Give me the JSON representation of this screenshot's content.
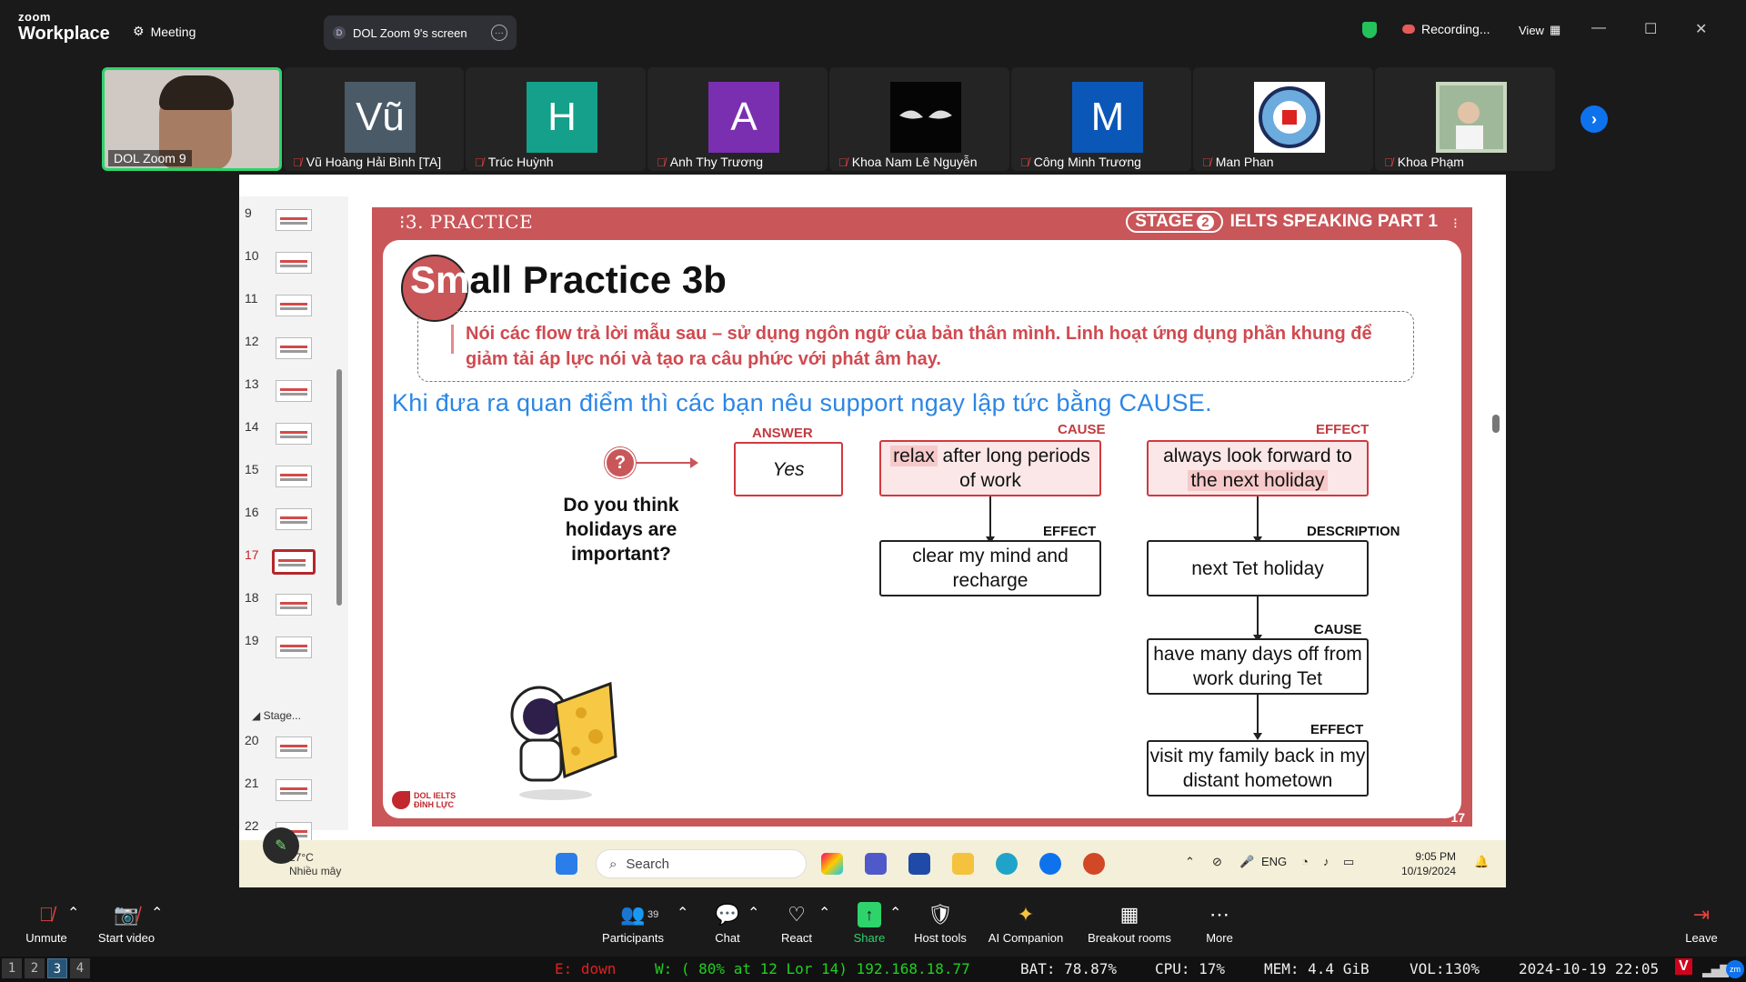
{
  "app": {
    "logo_line1": "zoom",
    "logo_line2": "Workplace",
    "meeting_label": "Meeting",
    "share_name": "DOL Zoom 9's screen",
    "share_badge": "D",
    "recording": "Recording...",
    "view": "View"
  },
  "participants": [
    {
      "name": "DOL Zoom 9",
      "initial": "",
      "color": ""
    },
    {
      "name": "Vũ Hoàng Hải Bình [TA]",
      "initial": "Vũ",
      "color": "#4a5a66"
    },
    {
      "name": "Trúc Huỳnh",
      "initial": "H",
      "color": "#14a08a"
    },
    {
      "name": "Anh Thy Trương",
      "initial": "A",
      "color": "#7a2fb0"
    },
    {
      "name": "Khoa Nam Lê Nguyễn",
      "initial": "",
      "color": "#050505"
    },
    {
      "name": "Công Minh Trương",
      "initial": "M",
      "color": "#0a57b8"
    },
    {
      "name": "Man Phan",
      "initial": "",
      "color": "#ffffff"
    },
    {
      "name": "Khoa Phạm",
      "initial": "",
      "color": "#c8d8c0"
    }
  ],
  "slides_panel": {
    "numbers": [
      "9",
      "10",
      "11",
      "12",
      "13",
      "14",
      "15",
      "16",
      "17",
      "18",
      "19",
      "20",
      "21",
      "22"
    ],
    "active": "17",
    "section": "Stage..."
  },
  "slide": {
    "section_header": "3. PRACTICE",
    "stage_label": "STAGE",
    "stage_num": "2",
    "part_label": "IELTS SPEAKING PART 1",
    "title_sm": "Sm",
    "title_rest": "all Practice 3b",
    "instruction": "Nói các flow trả lời mẫu sau – sử dụng ngôn ngữ của bản thân mình. Linh hoạt ứng dụng phần khung để giảm tải áp lực nói và tạo ra câu phức với phát âm hay.",
    "subline": "Khi đưa ra quan điểm thì các bạn nêu support ngay lập tức bằng CAUSE.",
    "question_mark": "?",
    "question": "Do you think holidays are important?",
    "answer_label": "ANSWER",
    "answer": "Yes",
    "cause_label": "CAUSE",
    "cause_hl": "relax",
    "cause_rest": " after long periods of work",
    "effect_label_1": "EFFECT",
    "effect_1": "clear my mind and recharge",
    "effect_label_2": "EFFECT",
    "effect_2_a": "always look forward to ",
    "effect_2_hl": "the next holiday",
    "desc_label": "DESCRIPTION",
    "desc": "next Tet holiday",
    "cause_label_2": "CAUSE",
    "cause_2": "have many days off from work during Tet",
    "effect_label_3": "EFFECT",
    "effect_3": "visit my family back in my distant hometown",
    "brand_1": "DOL IELTS",
    "brand_2": "ĐÌNH LỰC",
    "page": "17"
  },
  "win_taskbar": {
    "temp": "27°C",
    "weather": "Nhiều mây",
    "search": "Search",
    "lang": "ENG",
    "time": "9:05 PM",
    "date": "10/19/2024"
  },
  "toolbar": {
    "unmute": "Unmute",
    "start_video": "Start video",
    "participants": "Participants",
    "participant_count": "39",
    "chat": "Chat",
    "react": "React",
    "share": "Share",
    "host_tools": "Host tools",
    "ai_companion": "AI Companion",
    "breakout": "Breakout rooms",
    "more": "More",
    "leave": "Leave"
  },
  "statusbar": {
    "workspaces": [
      "1",
      "2",
      "3",
      "4"
    ],
    "active_ws": "3",
    "eth": "E: down",
    "wifi": "W: ( 80% at 12 Lor 14) 192.168.18.77",
    "bat": "BAT: 78.87%",
    "cpu": "CPU: 17%",
    "mem": "MEM: 4.4 GiB",
    "vol": "VOL:130%",
    "datetime": "2024-10-19 22:05"
  }
}
